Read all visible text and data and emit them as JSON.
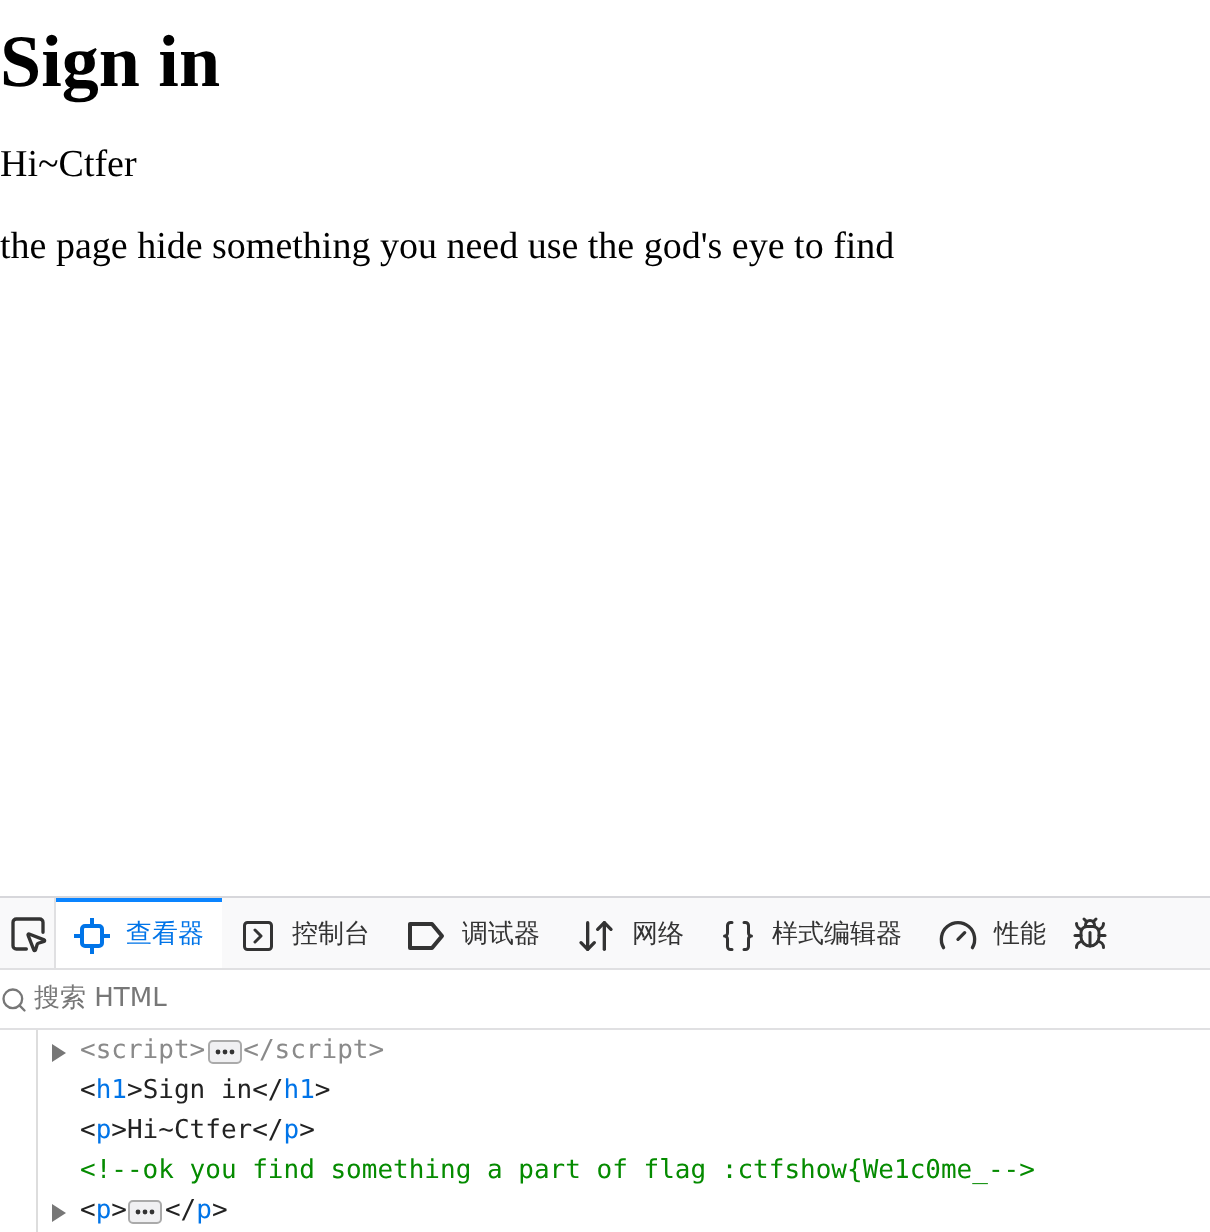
{
  "page": {
    "heading": "Sign in",
    "paragraphs": [
      "Hi~Ctfer",
      "the page hide something you need use the god's eye to find"
    ]
  },
  "devtools": {
    "tabs": [
      {
        "label": "查看器",
        "kind": "inspector",
        "selected": true
      },
      {
        "label": "控制台",
        "kind": "console",
        "selected": false
      },
      {
        "label": "调试器",
        "kind": "debugger",
        "selected": false
      },
      {
        "label": "网络",
        "kind": "network",
        "selected": false
      },
      {
        "label": "样式编辑器",
        "kind": "style",
        "selected": false
      },
      {
        "label": "性能",
        "kind": "performance",
        "selected": false
      }
    ],
    "search": {
      "placeholder": "搜索 HTML"
    },
    "tree": [
      {
        "expandable": true,
        "tokens": [
          {
            "kind": "dim",
            "text": "<script>"
          },
          {
            "kind": "more"
          },
          {
            "kind": "dim",
            "text": "</script>"
          }
        ]
      },
      {
        "expandable": false,
        "tokens": [
          {
            "kind": "bracket",
            "text": "<"
          },
          {
            "kind": "tag",
            "text": "h1"
          },
          {
            "kind": "bracket",
            "text": ">"
          },
          {
            "kind": "text",
            "text": "Sign in"
          },
          {
            "kind": "bracket",
            "text": "</"
          },
          {
            "kind": "tag",
            "text": "h1"
          },
          {
            "kind": "bracket",
            "text": ">"
          }
        ]
      },
      {
        "expandable": false,
        "tokens": [
          {
            "kind": "bracket",
            "text": "<"
          },
          {
            "kind": "tag",
            "text": "p"
          },
          {
            "kind": "bracket",
            "text": ">"
          },
          {
            "kind": "text",
            "text": "Hi~Ctfer"
          },
          {
            "kind": "bracket",
            "text": "</"
          },
          {
            "kind": "tag",
            "text": "p"
          },
          {
            "kind": "bracket",
            "text": ">"
          }
        ]
      },
      {
        "expandable": false,
        "tokens": [
          {
            "kind": "comment",
            "text": "<!--ok you find something a part of flag :ctfshow{We1c0me_-->"
          }
        ]
      },
      {
        "expandable": true,
        "tokens": [
          {
            "kind": "bracket",
            "text": "<"
          },
          {
            "kind": "tag",
            "text": "p"
          },
          {
            "kind": "bracket",
            "text": ">"
          },
          {
            "kind": "more"
          },
          {
            "kind": "bracket",
            "text": "</"
          },
          {
            "kind": "tag",
            "text": "p"
          },
          {
            "kind": "bracket",
            "text": ">"
          }
        ]
      }
    ]
  }
}
